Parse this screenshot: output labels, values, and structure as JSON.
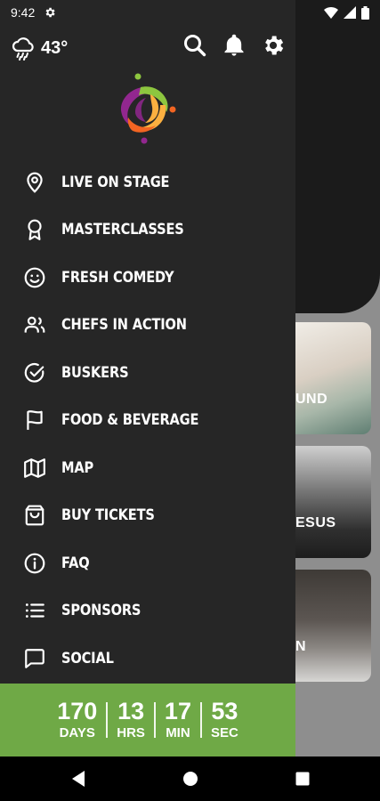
{
  "status_bar": {
    "time": "9:42"
  },
  "header": {
    "temperature": "43°"
  },
  "menu": [
    {
      "label": "LIVE ON STAGE",
      "icon": "location-pin-icon"
    },
    {
      "label": "MASTERCLASSES",
      "icon": "award-ribbon-icon"
    },
    {
      "label": "FRESH COMEDY",
      "icon": "smiley-icon"
    },
    {
      "label": "CHEFS IN ACTION",
      "icon": "people-icon"
    },
    {
      "label": "BUSKERS",
      "icon": "check-circle-icon"
    },
    {
      "label": "FOOD & BEVERAGE",
      "icon": "flag-icon"
    },
    {
      "label": "MAP",
      "icon": "map-icon"
    },
    {
      "label": "BUY TICKETS",
      "icon": "shopping-bag-icon"
    },
    {
      "label": "FAQ",
      "icon": "info-icon"
    },
    {
      "label": "SPONSORS",
      "icon": "list-icon"
    },
    {
      "label": "SOCIAL",
      "icon": "chat-bubble-icon"
    }
  ],
  "countdown": {
    "days": "170",
    "days_label": "DAYS",
    "hrs": "13",
    "hrs_label": "HRS",
    "min": "17",
    "min_label": "MIN",
    "sec": "53",
    "sec_label": "SEC"
  },
  "background_cards": [
    {
      "label": "UND"
    },
    {
      "label": "ESUS"
    },
    {
      "label": "N"
    }
  ],
  "colors": {
    "drawer": "#262626",
    "countdown": "#6fa946",
    "accent": "#6fa946"
  }
}
